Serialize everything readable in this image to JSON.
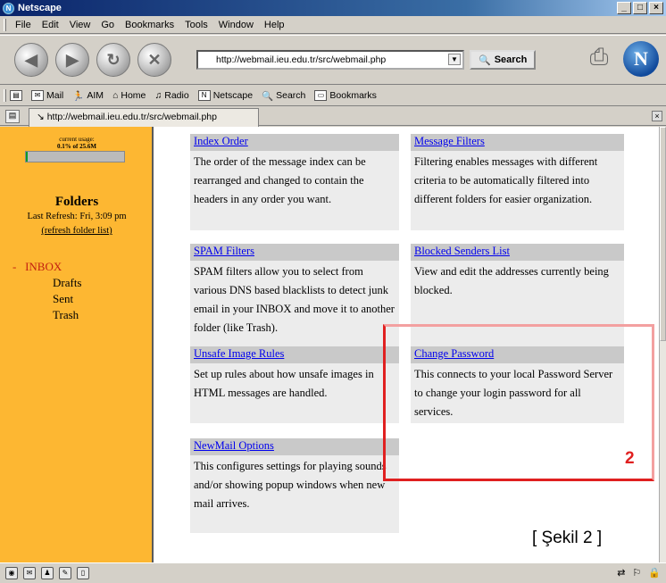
{
  "window": {
    "title": "Netscape",
    "buttons": {
      "minimize": "_",
      "maximize": "□",
      "close": "×"
    }
  },
  "menu": [
    "File",
    "Edit",
    "View",
    "Go",
    "Bookmarks",
    "Tools",
    "Window",
    "Help"
  ],
  "toolbar": {
    "url": "http://webmail.ieu.edu.tr/src/webmail.php",
    "search_label": "Search",
    "logo_letter": "N"
  },
  "personal_toolbar": [
    "Mail",
    "AIM",
    "Home",
    "Radio",
    "Netscape",
    "Search",
    "Bookmarks"
  ],
  "tab": {
    "label": "http://webmail.ieu.edu.tr/src/webmail.php"
  },
  "sidebar": {
    "usage_label": "current usage:",
    "usage_value": "0.1% of 25.6M",
    "usage_fraction": 0.001,
    "folders_title": "Folders",
    "last_refresh": "Last Refresh: Fri, 3:09 pm",
    "refresh_link": "(refresh folder list)",
    "inbox_prefix": "-",
    "folders": [
      "INBOX",
      "Drafts",
      "Sent",
      "Trash"
    ]
  },
  "options": [
    {
      "title": "Index Order",
      "desc": "The order of the message index can be rearranged and changed to contain the headers in any order you want."
    },
    {
      "title": "Message Filters",
      "desc": "Filtering enables messages with different criteria to be automatically filtered into different folders for easier organization."
    },
    {
      "title": "SPAM Filters",
      "desc": "SPAM filters allow you to select from various DNS based blacklists to detect junk email in your INBOX and move it to another folder (like Trash)."
    },
    {
      "title": "Blocked Senders List",
      "desc": "View and edit the addresses currently being blocked."
    },
    {
      "title": "Unsafe Image Rules",
      "desc": "Set up rules about how unsafe images in HTML messages are handled."
    },
    {
      "title": "Change Password",
      "desc": "This connects to your local Password Server to change your login password for all services."
    },
    {
      "title": "NewMail Options",
      "desc": "This configures settings for playing sounds and/or showing popup windows when new mail arrives."
    }
  ],
  "annotation": {
    "number": "2",
    "caption": "[ Şekil 2 ]",
    "color": "#e02020"
  }
}
